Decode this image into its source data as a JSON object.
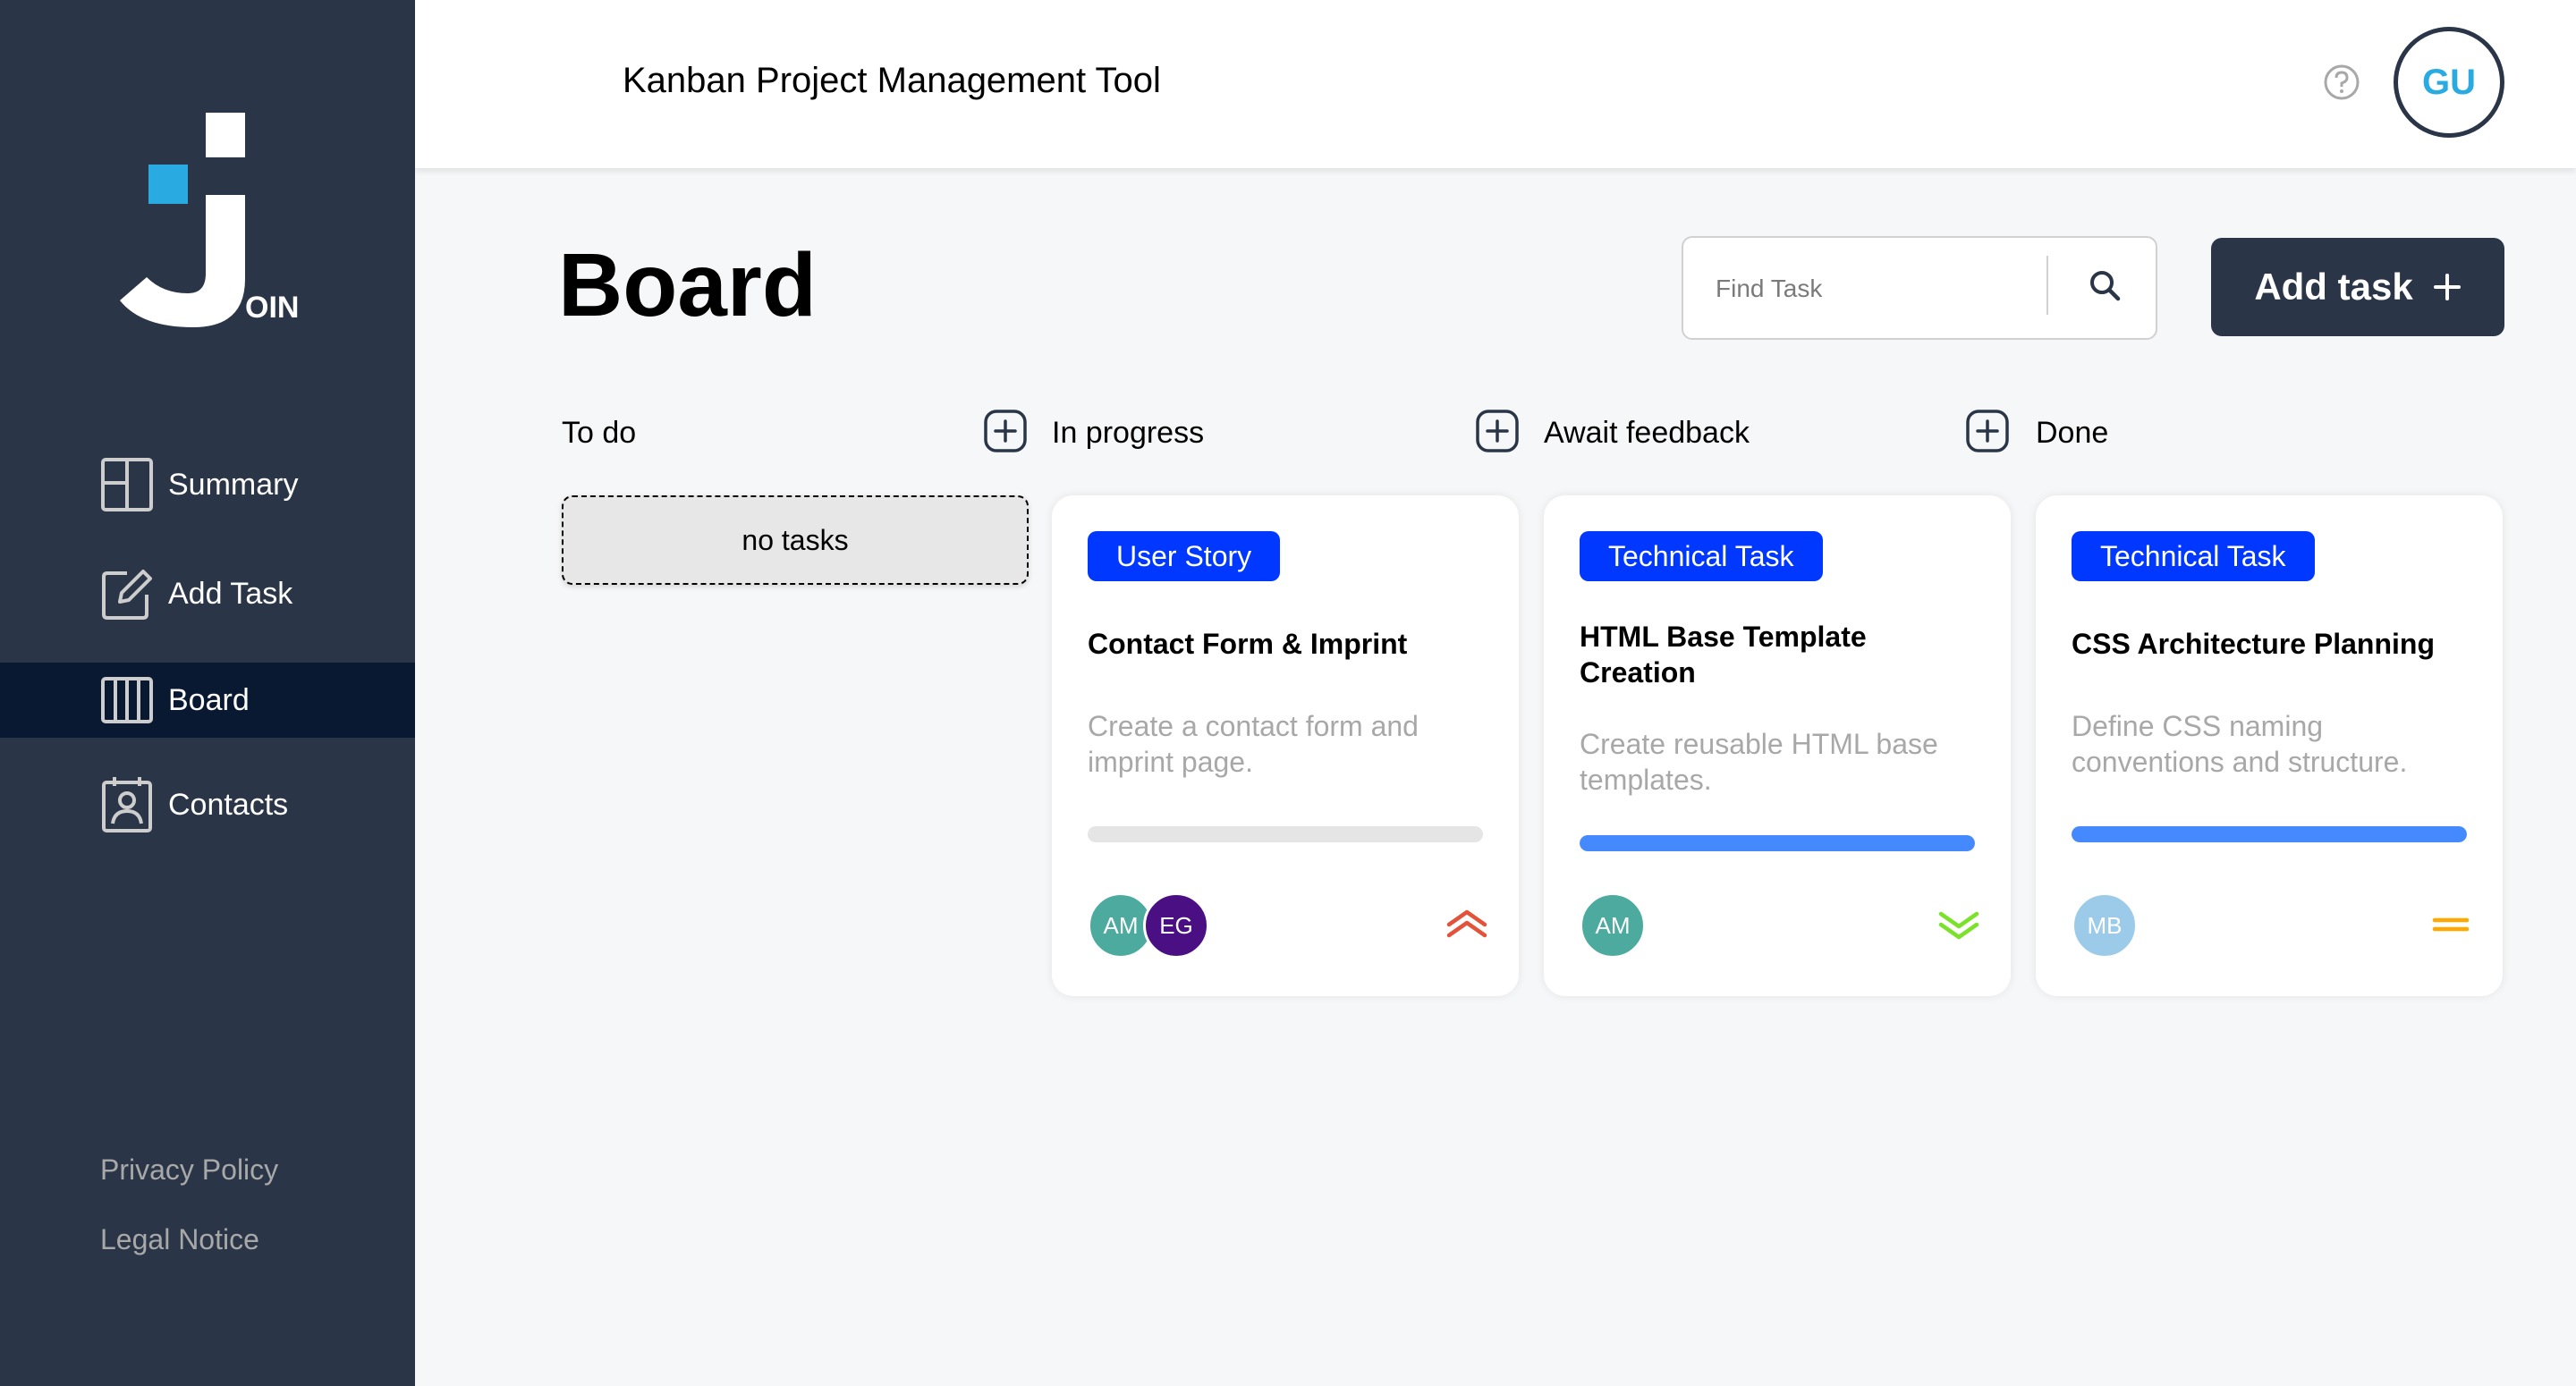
{
  "app": {
    "header_title": "Kanban Project Management Tool",
    "user_initials": "GU",
    "logo_letters": "OIN"
  },
  "sidebar": {
    "items": [
      {
        "label": "Summary",
        "icon": "summary-icon"
      },
      {
        "label": "Add Task",
        "icon": "edit-icon"
      },
      {
        "label": "Board",
        "icon": "board-icon",
        "active": true
      },
      {
        "label": "Contacts",
        "icon": "contacts-icon"
      }
    ],
    "footer": {
      "privacy": "Privacy Policy",
      "legal": "Legal Notice"
    }
  },
  "board": {
    "title": "Board",
    "search_placeholder": "Find Task",
    "add_task_label": "Add task",
    "columns": [
      {
        "title": "To do"
      },
      {
        "title": "In progress"
      },
      {
        "title": "Await feedback"
      },
      {
        "title": "Done"
      }
    ],
    "empty_label": "no tasks",
    "cards": [
      {
        "category": "User Story",
        "title": "Contact Form & Imprint",
        "description": "Create a contact form and imprint page.",
        "progress": 0,
        "assignees": [
          {
            "initials": "AM",
            "color": "#4cab9e"
          },
          {
            "initials": "EG",
            "color": "#4b0f84"
          }
        ],
        "priority": "urgent",
        "priority_color": "#e2533a"
      },
      {
        "category": "Technical Task",
        "title": "HTML Base Template Creation",
        "description": "Create reusable HTML base templates.",
        "progress": 1,
        "assignees": [
          {
            "initials": "AM",
            "color": "#4cab9e"
          }
        ],
        "priority": "low",
        "priority_color": "#7ae229"
      },
      {
        "category": "Technical Task",
        "title": "CSS Architecture Planning",
        "description": "Define CSS naming conventions and structure.",
        "progress": 1,
        "assignees": [
          {
            "initials": "MB",
            "color": "#9ccbea"
          }
        ],
        "priority": "medium",
        "priority_color": "#ffa800"
      }
    ]
  },
  "colors": {
    "sidebar_bg": "#2a3647",
    "sidebar_active": "#091931",
    "accent": "#29abe2",
    "tag_blue": "#0038ff",
    "progress_fill": "#4589ff"
  }
}
